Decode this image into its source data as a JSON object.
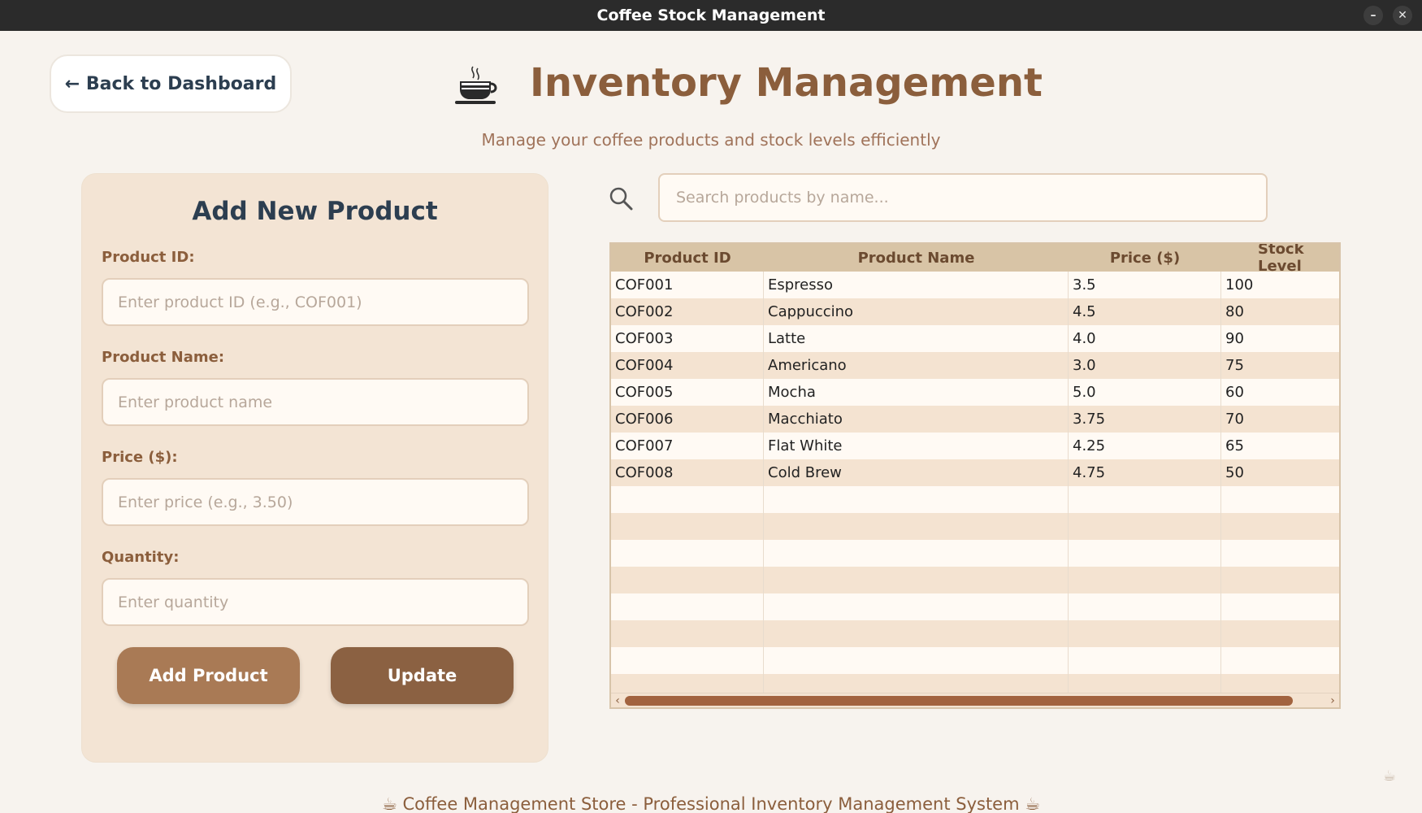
{
  "window": {
    "title": "Coffee Stock Management",
    "minimize": "–",
    "close": "✕"
  },
  "header": {
    "back_label": "← Back to Dashboard",
    "title": "Inventory Management",
    "subtitle": "Manage your coffee products and stock levels efficiently"
  },
  "form": {
    "title": "Add New Product",
    "product_id_label": "Product ID:",
    "product_id_placeholder": "Enter product ID (e.g., COF001)",
    "product_name_label": "Product Name:",
    "product_name_placeholder": "Enter product name",
    "price_label": "Price ($):",
    "price_placeholder": "Enter price (e.g., 3.50)",
    "quantity_label": "Quantity:",
    "quantity_placeholder": "Enter quantity",
    "add_label": "Add Product",
    "update_label": "Update"
  },
  "search": {
    "placeholder": "Search products by name..."
  },
  "table": {
    "headers": [
      "Product ID",
      "Product Name",
      "Price ($)",
      "Stock Level"
    ],
    "rows": [
      [
        "COF001",
        "Espresso",
        "3.5",
        "100"
      ],
      [
        "COF002",
        "Cappuccino",
        "4.5",
        "80"
      ],
      [
        "COF003",
        "Latte",
        "4.0",
        "90"
      ],
      [
        "COF004",
        "Americano",
        "3.0",
        "75"
      ],
      [
        "COF005",
        "Mocha",
        "5.0",
        "60"
      ],
      [
        "COF006",
        "Macchiato",
        "3.75",
        "70"
      ],
      [
        "COF007",
        "Flat White",
        "4.25",
        "65"
      ],
      [
        "COF008",
        "Cold Brew",
        "4.75",
        "50"
      ],
      [
        "",
        "",
        "",
        ""
      ],
      [
        "",
        "",
        "",
        ""
      ],
      [
        "",
        "",
        "",
        ""
      ],
      [
        "",
        "",
        "",
        ""
      ],
      [
        "",
        "",
        "",
        ""
      ],
      [
        "",
        "",
        "",
        ""
      ],
      [
        "",
        "",
        "",
        ""
      ],
      [
        "",
        "",
        "",
        ""
      ]
    ],
    "scroll_left": "‹",
    "scroll_right": "›"
  },
  "footer": {
    "text": "☕ Coffee Management Store - Professional Inventory Management System ☕",
    "corner_icon": "☕"
  },
  "colors": {
    "accent": "#8b5e3c",
    "panel": "#f3e4d4",
    "header_row": "#d8c4a6",
    "add_button": "#a97a55",
    "update_button": "#8b6142"
  }
}
